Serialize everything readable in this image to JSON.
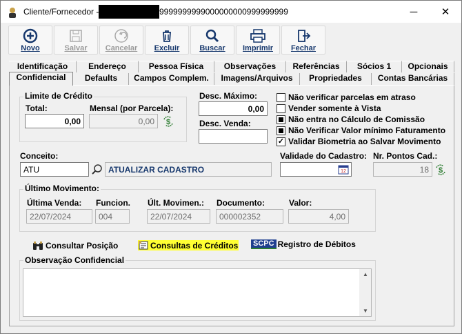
{
  "window": {
    "title": "Cliente/Fornecedor -",
    "title_suffix": "9999999999000000000999999999",
    "controls": {
      "minimize": "─",
      "maximize": "☐",
      "close": "✕"
    }
  },
  "toolbar": {
    "novo": "Novo",
    "salvar": "Salvar",
    "cancelar": "Cancelar",
    "excluir": "Excluir",
    "buscar": "Buscar",
    "imprimir": "Imprimir",
    "fechar": "Fechar"
  },
  "tabs_row1": [
    "Identificação",
    "Endereço",
    "Pessoa Física",
    "Observações",
    "Referências",
    "Sócios 1",
    "Opcionais"
  ],
  "tabs_row2": [
    "Confidencial",
    "Defaults",
    "Campos Complem.",
    "Imagens/Arquivos",
    "Propriedades",
    "Contas Bancárias"
  ],
  "limite": {
    "title": "Limite de Crédito",
    "total_label": "Total:",
    "total_value": "0,00",
    "mensal_label": "Mensal (por Parcela):",
    "mensal_value": "0,00"
  },
  "desc_maximo": {
    "label": "Desc. Máximo:",
    "value": "0,00"
  },
  "desc_venda": {
    "label": "Desc. Venda:",
    "value": ""
  },
  "checkboxes": [
    {
      "label": "Não verificar parcelas em atraso",
      "state": "unchecked"
    },
    {
      "label": "Vender somente à Vista",
      "state": "unchecked"
    },
    {
      "label": "Não entra no Cálculo de Comissão",
      "state": "filled"
    },
    {
      "label": "Não Verificar Valor mínimo Faturamento",
      "state": "filled"
    },
    {
      "label": "Validar Biometria ao Salvar Movimento",
      "state": "checked"
    }
  ],
  "conceito": {
    "label": "Conceito:",
    "code": "ATU",
    "description": "ATUALIZAR CADASTRO"
  },
  "validade": {
    "label": "Validade do Cadastro:",
    "value": ""
  },
  "pontos": {
    "label": "Nr. Pontos Cad.:",
    "value": "18"
  },
  "ultimo": {
    "title": "Último Movimento:",
    "ultima_venda_label": "Última Venda:",
    "ultima_venda": "22/07/2024",
    "funcion_label": "Funcion.",
    "funcion": "004",
    "ult_movimen_label": "Últ. Movimen.:",
    "ult_movimen": "22/07/2024",
    "documento_label": "Documento:",
    "documento": "000002352",
    "valor_label": "Valor:",
    "valor": "4,00"
  },
  "links": {
    "consultar_posicao": "Consultar Posição",
    "consultas_creditos": "Consultas de Créditos",
    "scpc_logo": "SCPC",
    "registro_debitos": "Registro de Débitos"
  },
  "observacao": {
    "title": "Observação Confidencial",
    "value": ""
  },
  "colors": {
    "accent_blue": "#17386d",
    "highlight": "#ffff33"
  }
}
